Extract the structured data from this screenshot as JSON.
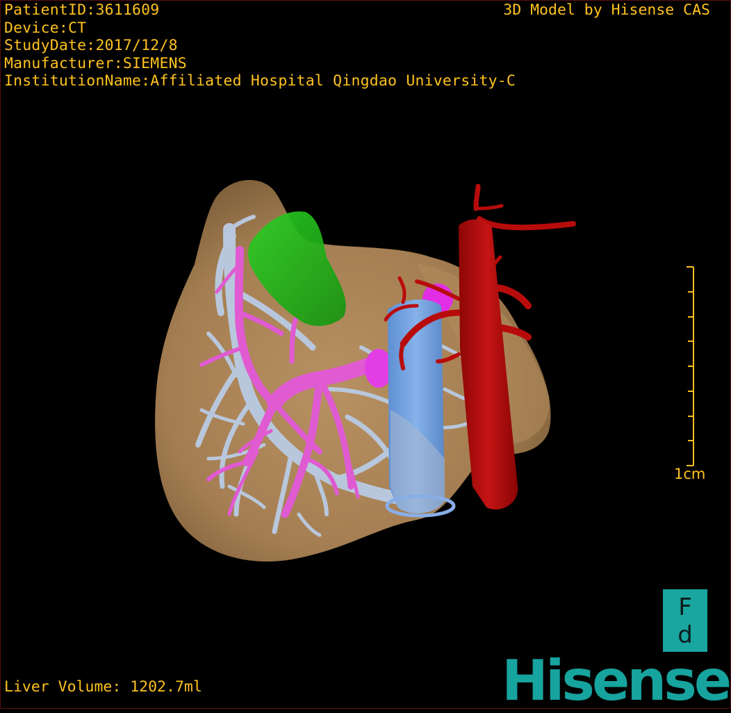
{
  "overlay": {
    "patient_id": "PatientID:3611609",
    "device": "Device:CT",
    "study_date": "StudyDate:2017/12/8",
    "manufacturer": "Manufacturer:SIEMENS",
    "institution": "InstitutionName:Affiliated Hospital Qingdao University-C",
    "model_credit": "3D Model by Hisense CAS",
    "liver_volume": "Liver Volume: 1202.7ml"
  },
  "scale_bar": {
    "label": "1cm"
  },
  "orientation_cube": {
    "top_letter": "F",
    "bottom_letter": "d"
  },
  "logo": {
    "text": "Hisense"
  },
  "colors": {
    "overlay_text": "#ffc21f",
    "liver": "#a9845a",
    "portal_vein": "#e05ad2",
    "hepatic_vein": "#b8c7dc",
    "gallbladder": "#1fb81a",
    "vena_cava": "#6b9fdd",
    "aorta": "#b80c0c",
    "logo": "#17a39e"
  }
}
